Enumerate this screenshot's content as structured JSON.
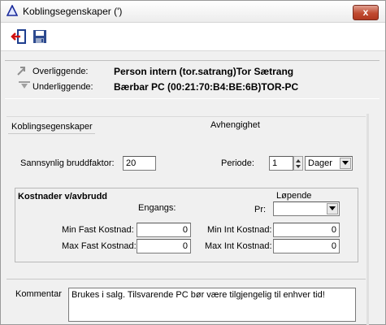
{
  "window": {
    "title": "Koblingsegenskaper (')",
    "close_label": "x"
  },
  "toolbar": {
    "exit_icon": "exit-icon",
    "save_icon": "save-icon"
  },
  "relations": {
    "over_label": "Overliggende:",
    "over_value": "Person intern (tor.satrang)Tor Sætrang",
    "under_label": "Underliggende:",
    "under_value": "Bærbar PC (00:21:70:B4:BE:6B)TOR-PC"
  },
  "tabs": {
    "tab1": "Koblingsegenskaper",
    "tab2": "Avhengighet"
  },
  "form": {
    "break_factor_label": "Sannsynlig bruddfaktor:",
    "break_factor_value": "20",
    "period_label": "Periode:",
    "period_value": "1",
    "period_unit": "Dager"
  },
  "costs": {
    "title": "Kostnader v/avbrudd",
    "once_label": "Engangs:",
    "running_label": "Løpende",
    "per_label": "Pr:",
    "per_value": "",
    "min_fixed_label": "Min Fast Kostnad:",
    "min_fixed_value": "0",
    "max_fixed_label": "Max Fast Kostnad:",
    "max_fixed_value": "0",
    "min_int_label": "Min Int Kostnad:",
    "min_int_value": "0",
    "max_int_label": "Max Int Kostnad:",
    "max_int_value": "0"
  },
  "comment": {
    "label": "Kommentar",
    "value": "Brukes i salg. Tilsvarende PC bør være tilgjengelig til enhver tid!"
  }
}
